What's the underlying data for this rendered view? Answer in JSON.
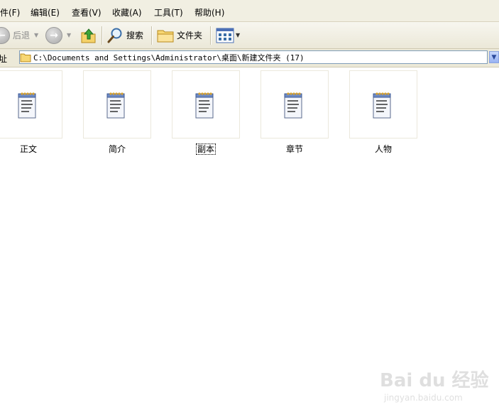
{
  "menu": {
    "file": "件(F)",
    "edit": "编辑(E)",
    "view": "查看(V)",
    "favorites": "收藏(A)",
    "tools": "工具(T)",
    "help": "帮助(H)"
  },
  "toolbar": {
    "back_label": "后退",
    "search_label": "搜索",
    "folders_label": "文件夹"
  },
  "address": {
    "label": "址",
    "path": "C:\\Documents and Settings\\Administrator\\桌面\\新建文件夹 (17)"
  },
  "files": [
    {
      "name": "正文"
    },
    {
      "name": "简介"
    },
    {
      "name": "副本"
    },
    {
      "name": "章节"
    },
    {
      "name": "人物"
    }
  ],
  "watermark": {
    "logo": "Bai du 经验",
    "sub": "jingyan.baidu.com"
  }
}
